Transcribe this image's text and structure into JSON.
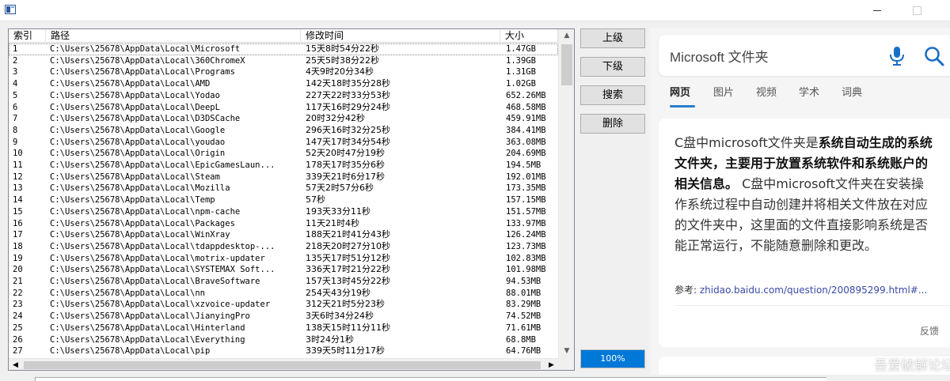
{
  "columns": {
    "index": "索引",
    "path": "路径",
    "modified": "修改时间",
    "size": "大小"
  },
  "rows": [
    {
      "index": "1",
      "path": "C:\\Users\\25678\\AppData\\Local\\Microsoft",
      "modified": "15天8时54分22秒",
      "size": "1.47GB"
    },
    {
      "index": "2",
      "path": "C:\\Users\\25678\\AppData\\Local\\360ChromeX",
      "modified": "25天5时38分22秒",
      "size": "1.39GB"
    },
    {
      "index": "3",
      "path": "C:\\Users\\25678\\AppData\\Local\\Programs",
      "modified": "4天9时20分34秒",
      "size": "1.31GB"
    },
    {
      "index": "4",
      "path": "C:\\Users\\25678\\AppData\\Local\\AMD",
      "modified": "142天18时35分28秒",
      "size": "1.02GB"
    },
    {
      "index": "5",
      "path": "C:\\Users\\25678\\AppData\\Local\\Yodao",
      "modified": "227天22时33分53秒",
      "size": "652.26MB"
    },
    {
      "index": "6",
      "path": "C:\\Users\\25678\\AppData\\Local\\DeepL",
      "modified": "117天16时29分24秒",
      "size": "468.58MB"
    },
    {
      "index": "7",
      "path": "C:\\Users\\25678\\AppData\\Local\\D3DSCache",
      "modified": "20时32分42秒",
      "size": "459.91MB"
    },
    {
      "index": "8",
      "path": "C:\\Users\\25678\\AppData\\Local\\Google",
      "modified": "296天16时32分25秒",
      "size": "384.41MB"
    },
    {
      "index": "9",
      "path": "C:\\Users\\25678\\AppData\\Local\\youdao",
      "modified": "147天17时34分54秒",
      "size": "363.08MB"
    },
    {
      "index": "10",
      "path": "C:\\Users\\25678\\AppData\\Local\\Origin",
      "modified": "52天20时47分19秒",
      "size": "204.69MB"
    },
    {
      "index": "11",
      "path": "C:\\Users\\25678\\AppData\\Local\\EpicGamesLaun...",
      "modified": "178天17时35分6秒",
      "size": "194.5MB"
    },
    {
      "index": "12",
      "path": "C:\\Users\\25678\\AppData\\Local\\Steam",
      "modified": "339天21时6分17秒",
      "size": "192.01MB"
    },
    {
      "index": "13",
      "path": "C:\\Users\\25678\\AppData\\Local\\Mozilla",
      "modified": "57天2时57分6秒",
      "size": "173.35MB"
    },
    {
      "index": "14",
      "path": "C:\\Users\\25678\\AppData\\Local\\Temp",
      "modified": "57秒",
      "size": "157.15MB"
    },
    {
      "index": "15",
      "path": "C:\\Users\\25678\\AppData\\Local\\npm-cache",
      "modified": "193天33分11秒",
      "size": "151.57MB"
    },
    {
      "index": "16",
      "path": "C:\\Users\\25678\\AppData\\Local\\Packages",
      "modified": "11天21时4秒",
      "size": "133.97MB"
    },
    {
      "index": "17",
      "path": "C:\\Users\\25678\\AppData\\Local\\WinXray",
      "modified": "188天21时41分43秒",
      "size": "126.24MB"
    },
    {
      "index": "18",
      "path": "C:\\Users\\25678\\AppData\\Local\\tdappdesktop-...",
      "modified": "218天20时27分10秒",
      "size": "123.73MB"
    },
    {
      "index": "19",
      "path": "C:\\Users\\25678\\AppData\\Local\\motrix-updater",
      "modified": "135天17时51分12秒",
      "size": "102.83MB"
    },
    {
      "index": "20",
      "path": "C:\\Users\\25678\\AppData\\Local\\SYSTEMAX Soft...",
      "modified": "336天17时21分22秒",
      "size": "101.98MB"
    },
    {
      "index": "21",
      "path": "C:\\Users\\25678\\AppData\\Local\\BraveSoftware",
      "modified": "157天13时45分22秒",
      "size": "94.53MB"
    },
    {
      "index": "22",
      "path": "C:\\Users\\25678\\AppData\\Local\\nn",
      "modified": "254天43分19秒",
      "size": "88.01MB"
    },
    {
      "index": "23",
      "path": "C:\\Users\\25678\\AppData\\Local\\xzvoice-updater",
      "modified": "312天21时5分23秒",
      "size": "83.29MB"
    },
    {
      "index": "24",
      "path": "C:\\Users\\25678\\AppData\\Local\\JianyingPro",
      "modified": "3天6时34分24秒",
      "size": "74.52MB"
    },
    {
      "index": "25",
      "path": "C:\\Users\\25678\\AppData\\Local\\Hinterland",
      "modified": "138天15时11分11秒",
      "size": "71.61MB"
    },
    {
      "index": "26",
      "path": "C:\\Users\\25678\\AppData\\Local\\Everything",
      "modified": "3时24分1秒",
      "size": "68.8MB"
    },
    {
      "index": "27",
      "path": "C:\\Users\\25678\\AppData\\Local\\pip",
      "modified": "339天5时11分17秒",
      "size": "64.76MB"
    }
  ],
  "buttons": {
    "up": "上级",
    "down": "下级",
    "search": "搜索",
    "delete": "删除"
  },
  "progress": {
    "label": "100%",
    "value": 100
  },
  "search": {
    "query": "Microsoft 文件夹"
  },
  "tabs": [
    "网页",
    "图片",
    "视频",
    "学术",
    "词典"
  ],
  "answer": {
    "part1": "C盘中microsoft文件夹是",
    "bold": "系统自动生成的系统文件夹，主要用于放置系统软件和系统账户的相关信息。",
    "part2": " C盘中microsoft文件夹在安装操作系统过程中自动创建并将相关文件放在对应的文件夹中，这里面的文件直接影响系统是否能正常运行，不能随意删除和更改。"
  },
  "reference": {
    "label": "参考:",
    "link": "zhidao.baidu.com/question/200895299.html#..."
  },
  "feedback": "反馈",
  "watermark": "吾爱破解论坛",
  "colors": {
    "accent": "#0078d7",
    "tab_underline": "#2a7ec7",
    "link": "#3a4ba7"
  }
}
